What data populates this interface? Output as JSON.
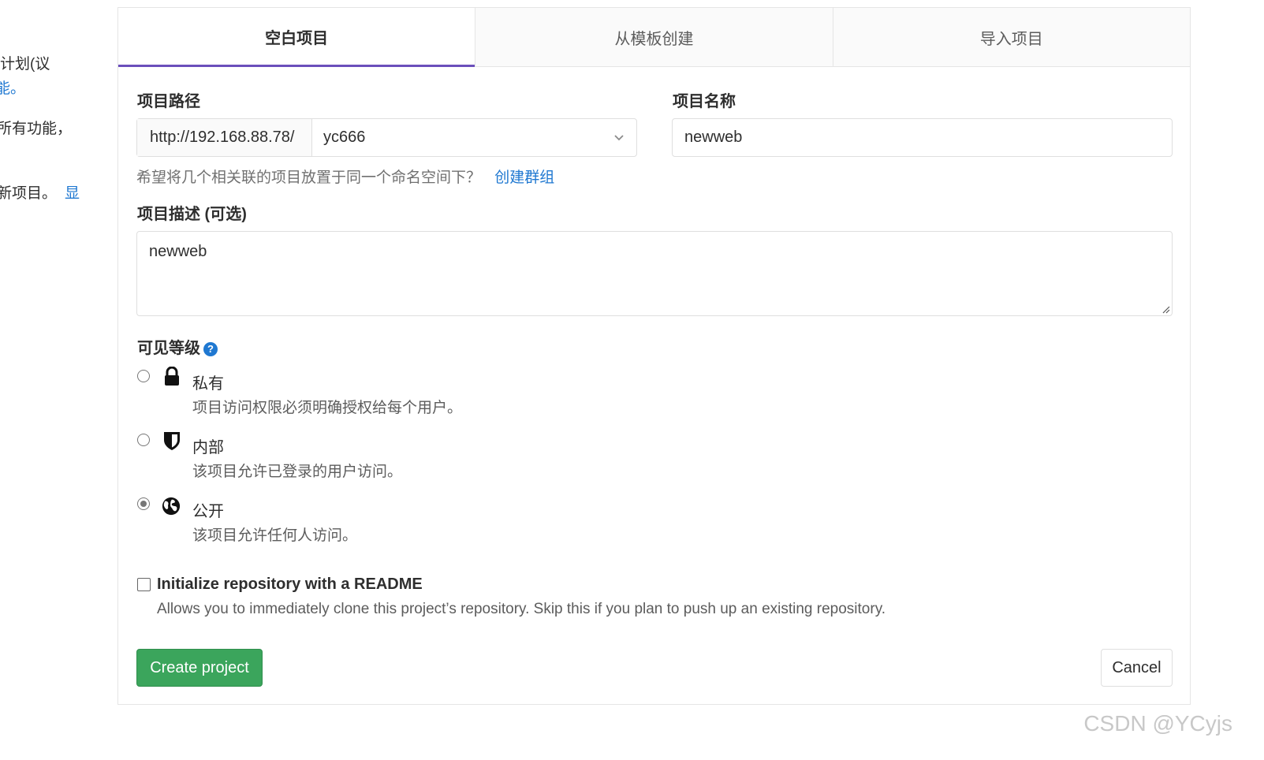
{
  "sidebar_fragments": [
    "计划(议",
    "能。",
    "所有功能，",
    "新项目。",
    "显"
  ],
  "tabs": [
    {
      "label": "空白项目",
      "active": true
    },
    {
      "label": "从模板创建",
      "active": false
    },
    {
      "label": "导入项目",
      "active": false
    }
  ],
  "form": {
    "path_label": "项目路径",
    "path_prefix": "http://192.168.88.78/",
    "namespace": "yc666",
    "name_label": "项目名称",
    "name_value": "newweb",
    "group_help": "希望将几个相关联的项目放置于同一个命名空间下？",
    "create_group_link": "创建群组",
    "desc_label": "项目描述 (可选)",
    "desc_value": "newweb",
    "visibility_label": "可见等级",
    "visibility_options": [
      {
        "title": "私有",
        "desc": "项目访问权限必须明确授权给每个用户。",
        "icon": "lock-icon",
        "checked": false
      },
      {
        "title": "内部",
        "desc": "该项目允许已登录的用户访问。",
        "icon": "shield-icon",
        "checked": false
      },
      {
        "title": "公开",
        "desc": "该项目允许任何人访问。",
        "icon": "globe-icon",
        "checked": true
      }
    ],
    "readme_label": "Initialize repository with a README",
    "readme_desc": "Allows you to immediately clone this project’s repository. Skip this if you plan to push up an existing repository.",
    "create_button": "Create project",
    "cancel_button": "Cancel"
  },
  "watermark": "CSDN @YCyjs",
  "colors": {
    "accent": "#6b4fbb",
    "link": "#1f78d1",
    "success": "#3ba55c"
  }
}
